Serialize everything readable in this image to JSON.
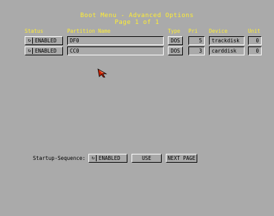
{
  "header": {
    "title": "Boot Menu - Advanced Options",
    "page_label": "Page  1 of  1"
  },
  "columns": {
    "status": "Status",
    "partition_name": "Partition Name",
    "type": "Type",
    "pri": "Pri",
    "device": "Device",
    "unit": "Unit"
  },
  "rows": [
    {
      "status": "ENABLED",
      "name": "DF0",
      "type": "DOS",
      "pri": "5",
      "device": "trackdisk",
      "unit": "0"
    },
    {
      "status": "ENABLED",
      "name": "CC0",
      "type": "DOS",
      "pri": "3",
      "device": "carddisk",
      "unit": "0"
    }
  ],
  "footer": {
    "startup_label": "Startup-Sequence:",
    "startup_value": "ENABLED",
    "use_label": "USE",
    "next_page_label": "NEXT PAGE"
  },
  "colors": {
    "background": "#aaaaaa",
    "highlight_text": "#ffee33",
    "pointer": "#cc2200"
  }
}
